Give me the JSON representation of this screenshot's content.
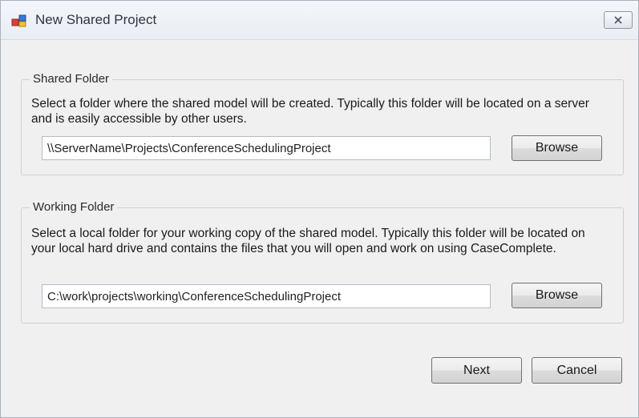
{
  "window": {
    "title": "New Shared Project",
    "close_glyph": "✕"
  },
  "shared_folder": {
    "legend": "Shared Folder",
    "description": "Select a folder where the shared model will be created. Typically this folder will be located on a server and is easily accessible by other users.",
    "path_value": "\\\\ServerName\\Projects\\ConferenceSchedulingProject",
    "browse_label": "Browse"
  },
  "working_folder": {
    "legend": "Working Folder",
    "description": "Select a local folder for your working copy of the shared model. Typically this folder will be located on your local hard drive and contains the files that you will open and work on using CaseComplete.",
    "path_value": "C:\\work\\projects\\working\\ConferenceSchedulingProject",
    "browse_label": "Browse"
  },
  "footer": {
    "next_label": "Next",
    "cancel_label": "Cancel"
  },
  "icons": {
    "app": "shared-project-icon",
    "close": "close-icon"
  }
}
